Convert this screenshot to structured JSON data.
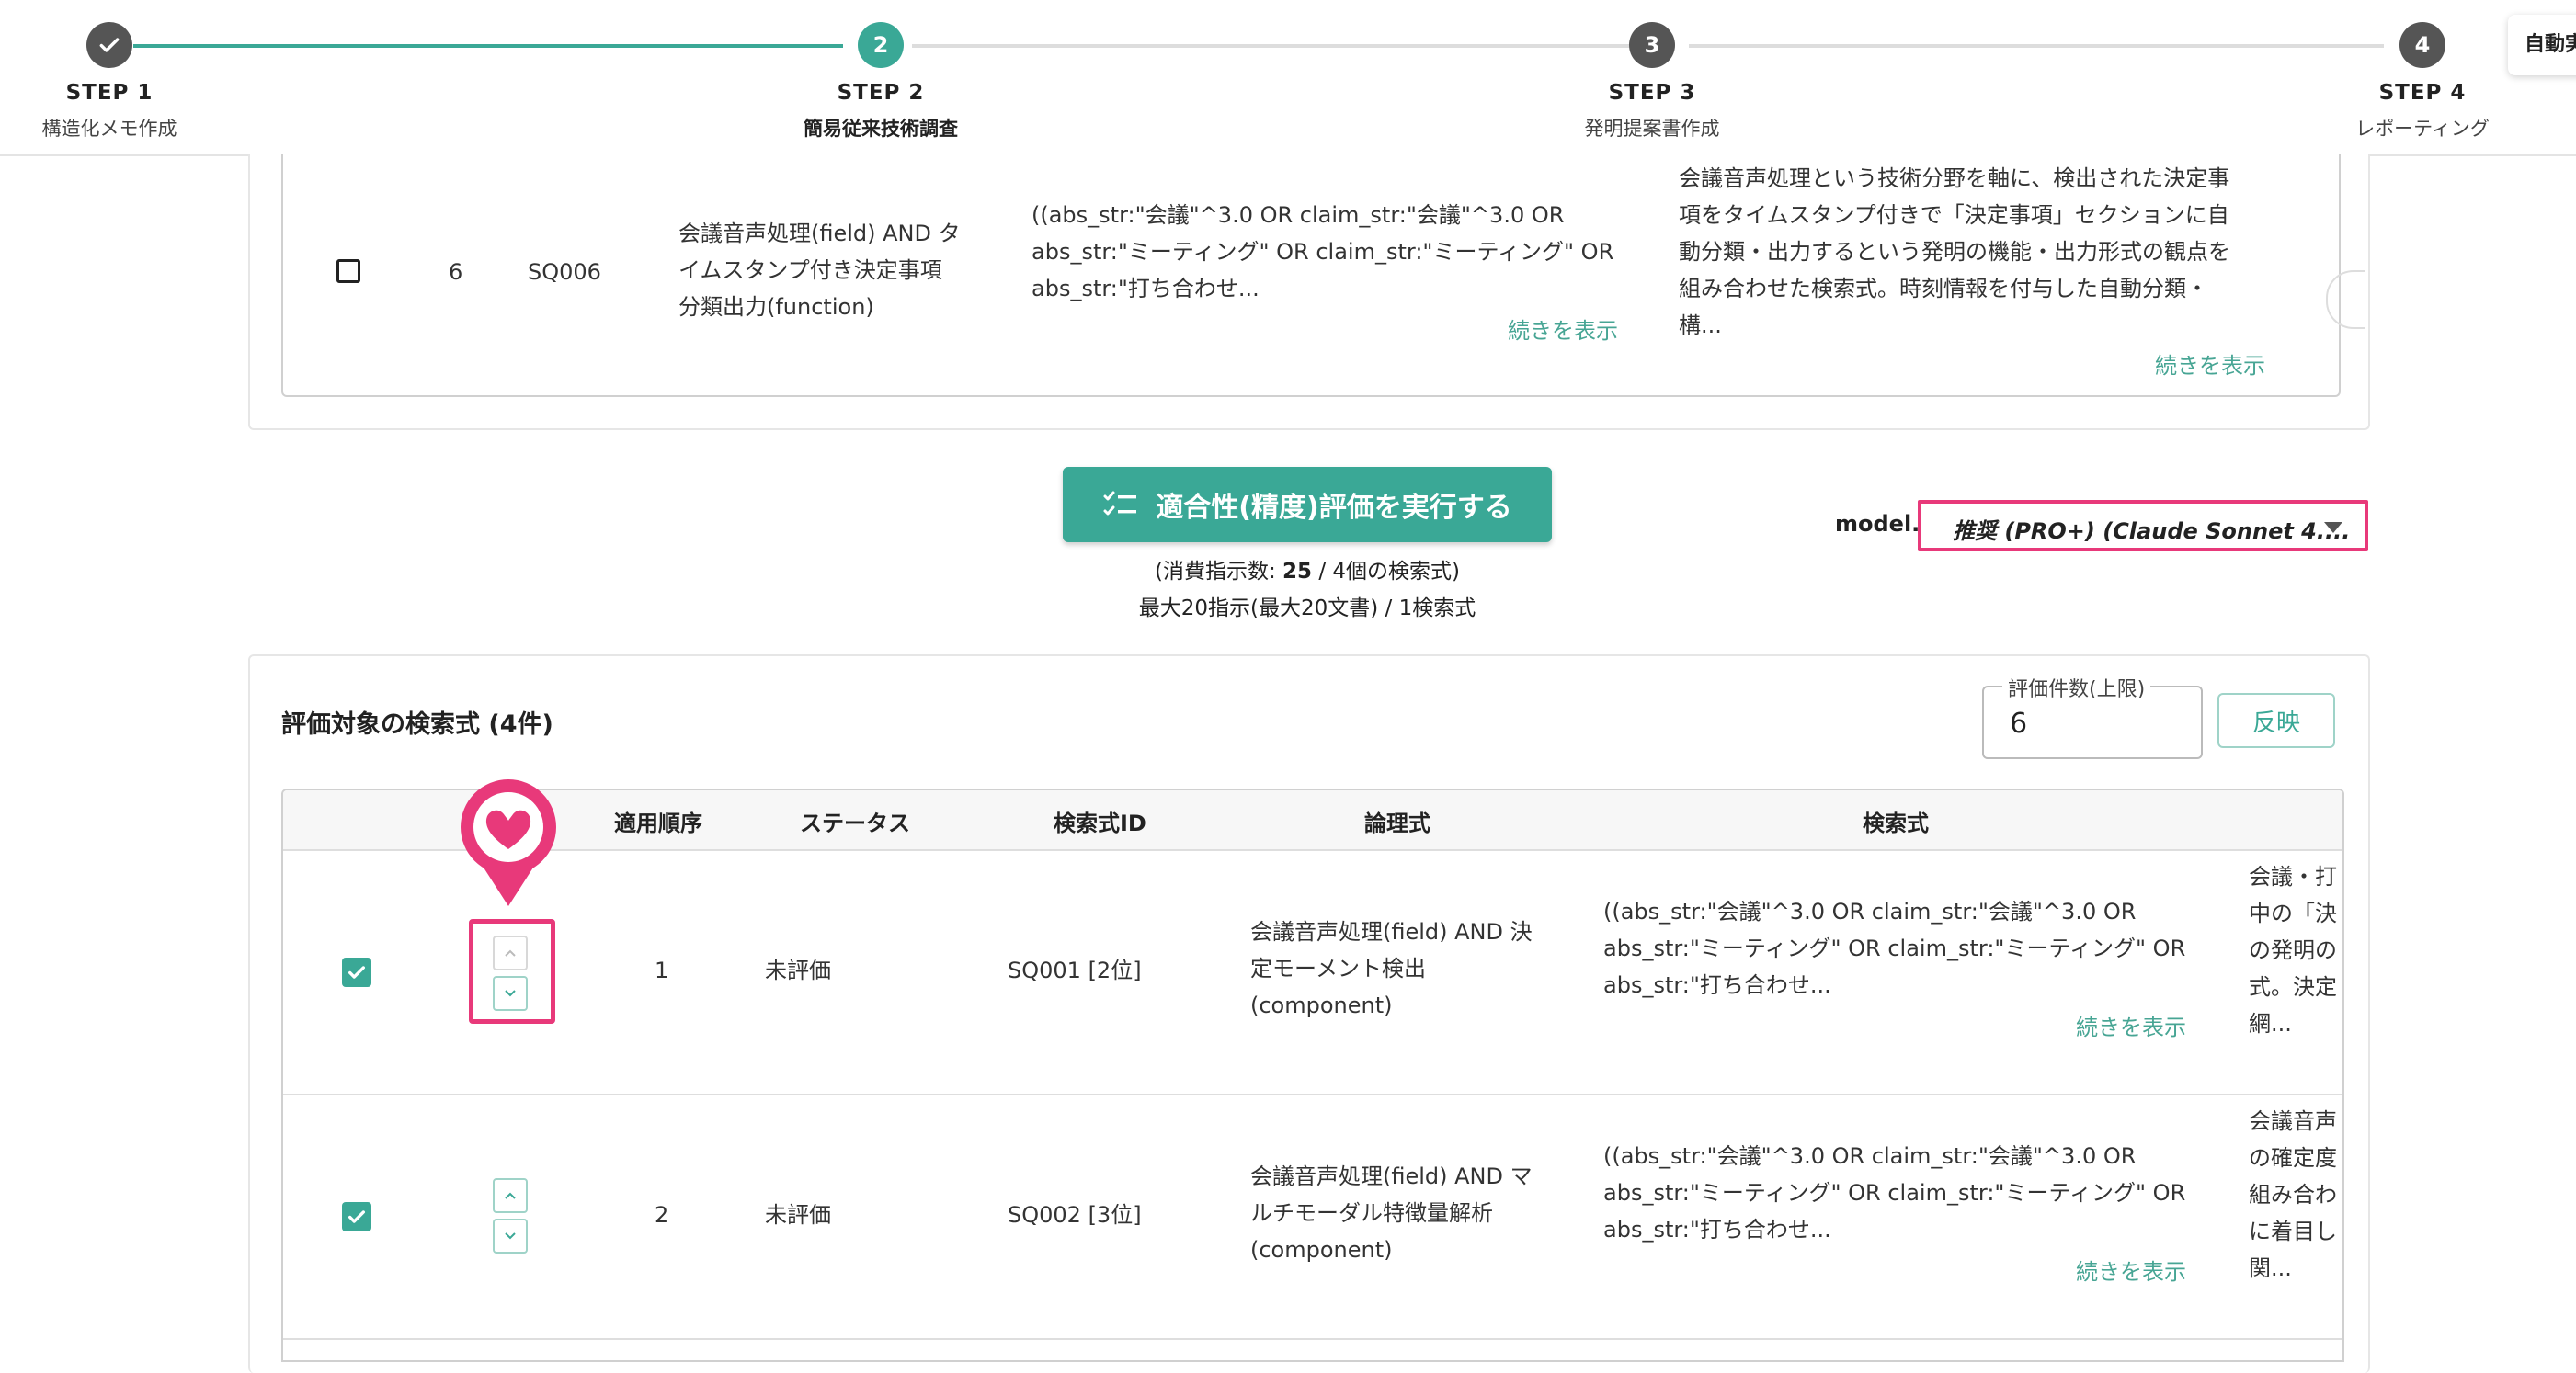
{
  "stepper": {
    "steps": [
      {
        "title": "STEP 1",
        "subtitle": "構造化メモ作成",
        "badge": "✓"
      },
      {
        "title": "STEP 2",
        "subtitle": "簡易従来技術調査",
        "badge": "2"
      },
      {
        "title": "STEP 3",
        "subtitle": "発明提案書作成",
        "badge": "3"
      },
      {
        "title": "STEP 4",
        "subtitle": "レポーティング",
        "badge": "4"
      }
    ],
    "auto_button": "自動実行",
    "colors": {
      "done": "#555555",
      "active": "#3aa896",
      "pending": "#555555",
      "line_done": "#3aa896",
      "line_pending": "#dddddd"
    }
  },
  "top_table": {
    "row": {
      "no": "6",
      "id": "SQ006",
      "logic": [
        "会議音声処理(field) AND タ",
        "イムスタンプ付き決定事項",
        "分類出力(function)"
      ],
      "query": [
        "((abs_str:\"会議\"^3.0 OR claim_str:\"会議\"^3.0 OR",
        "abs_str:\"ミーティング\" OR claim_str:\"ミーティング\" OR",
        "abs_str:\"打ち合わせ..."
      ],
      "query_more": "続きを表示",
      "desc": [
        "会議音声処理という技術分野を軸に、検出された決定事",
        "項をタイムスタンプ付きで「決定事項」セクションに自",
        "動分類・出力するという発明の機能・出力形式の観点を",
        "組み合わせた検索式。時刻情報を付与した自動分類・",
        "構..."
      ],
      "desc_more": "続きを表示"
    }
  },
  "run": {
    "button_label": "適合性(精度)評価を実行する",
    "cost_prefix": "(消費指示数: ",
    "cost_value": "25",
    "cost_suffix": " / 4個の検索式)",
    "limit_note": "最大20指示(最大20文書) / 1検索式"
  },
  "model": {
    "label": "model.",
    "selected": "推奨 (PRO+) (Claude Sonnet 4...."
  },
  "evaluation": {
    "title": "評価対象の検索式 (4件)",
    "limit_label": "評価件数(上限)",
    "limit_value": "6",
    "apply_label": "反映",
    "columns": [
      "適用順序",
      "ステータス",
      "検索式ID",
      "論理式",
      "検索式"
    ],
    "rows": [
      {
        "order": "1",
        "status": "未評価",
        "id": "SQ001 [2位]",
        "logic": [
          "会議音声処理(field) AND 決",
          "定モーメント検出",
          "(component)"
        ],
        "query": [
          "((abs_str:\"会議\"^3.0 OR claim_str:\"会議\"^3.0 OR",
          "abs_str:\"ミーティング\" OR claim_str:\"ミーティング\" OR",
          "abs_str:\"打ち合わせ..."
        ],
        "query_more": "続きを表示",
        "desc": [
          "会議・打",
          "中の「決",
          "の発明の",
          "式。決定",
          "網..."
        ]
      },
      {
        "order": "2",
        "status": "未評価",
        "id": "SQ002 [3位]",
        "logic": [
          "会議音声処理(field) AND マ",
          "ルチモーダル特徴量解析",
          "(component)"
        ],
        "query": [
          "((abs_str:\"会議\"^3.0 OR claim_str:\"会議\"^3.0 OR",
          "abs_str:\"ミーティング\" OR claim_str:\"ミーティング\" OR",
          "abs_str:\"打ち合わせ..."
        ],
        "query_more": "続きを表示",
        "desc": [
          "会議音声",
          "の確定度",
          "組み合わ",
          "に着目し",
          "関..."
        ]
      }
    ]
  },
  "colors": {
    "accent": "#3aa896",
    "highlight": "#e8397a",
    "link": "#47a594"
  }
}
